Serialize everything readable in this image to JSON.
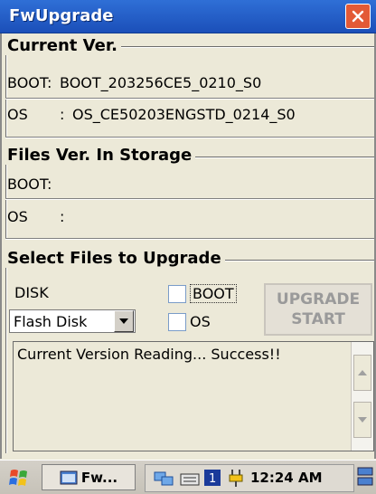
{
  "window": {
    "title": "FwUpgrade"
  },
  "current_ver": {
    "title": "Current Ver.",
    "boot_label": "BOOT",
    "boot_value": "BOOT_203256CE5_0210_S0",
    "os_label": "OS",
    "os_value": "OS_CE50203ENGSTD_0214_S0"
  },
  "storage": {
    "title": "Files Ver. In Storage",
    "boot_label": "BOOT",
    "os_label": "OS",
    "colon": ":"
  },
  "select_files": {
    "title": "Select Files to Upgrade",
    "disk_label": "DISK",
    "disk_selected": "Flash Disk",
    "boot_checkbox": "BOOT",
    "os_checkbox": "OS",
    "upgrade_line1": "UPGRADE",
    "upgrade_line2": "START"
  },
  "log": {
    "text": "Current Version Reading... Success!!"
  },
  "taskbar": {
    "task_label": "Fw...",
    "clock": "12:24 AM"
  },
  "colors": {
    "titlebar": "#2f6fd6",
    "close": "#e35a36",
    "background": "#ece9d8"
  }
}
